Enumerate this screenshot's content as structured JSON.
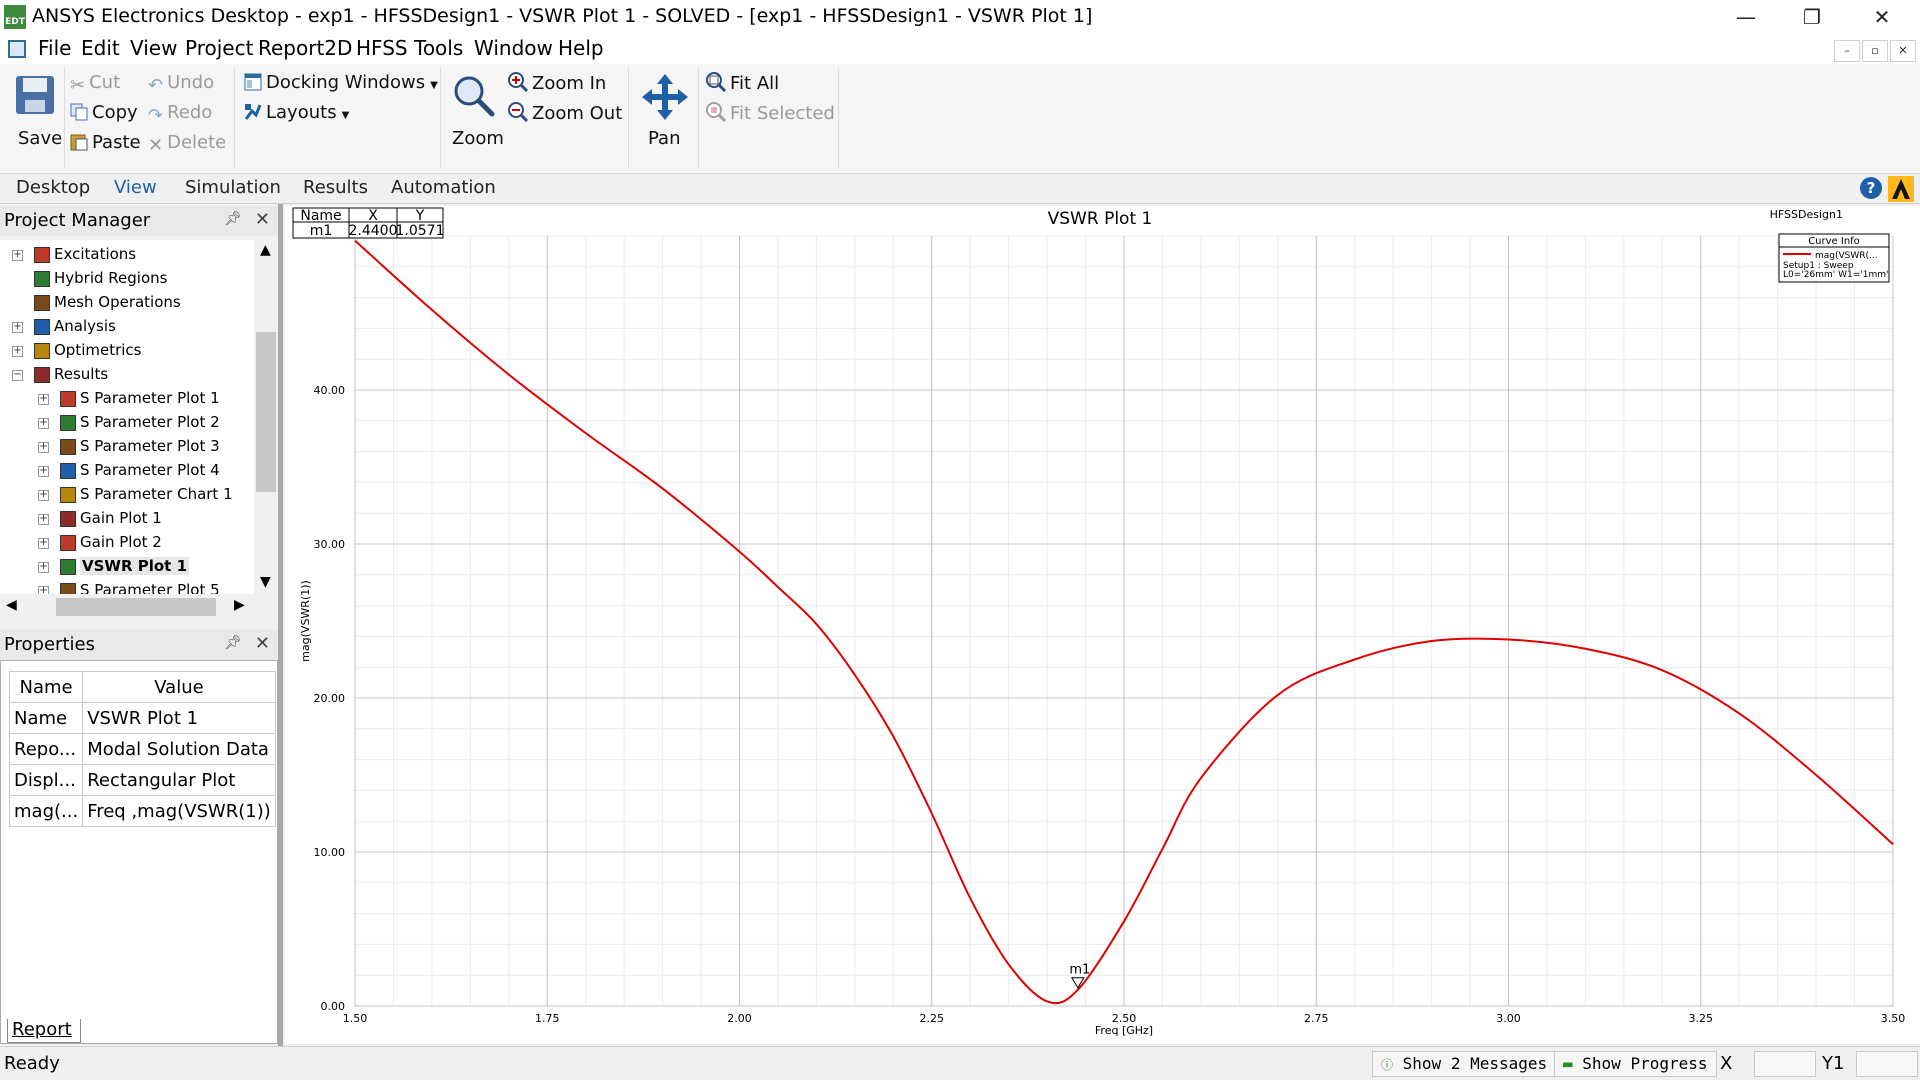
{
  "window": {
    "title": "ANSYS Electronics Desktop - exp1 - HFSSDesign1 - VSWR Plot 1 - SOLVED - [exp1 - HFSSDesign1 - VSWR Plot 1]",
    "app_icon_text": "EDT",
    "minimize": "—",
    "restore": "❐",
    "close": "✕"
  },
  "menu": {
    "items": [
      "File",
      "Edit",
      "View",
      "Project",
      "Report2D",
      "HFSS",
      "Tools",
      "Window",
      "Help"
    ]
  },
  "ribbon": {
    "save": "Save",
    "cut": "Cut",
    "copy": "Copy",
    "paste": "Paste",
    "undo": "Undo",
    "redo": "Redo",
    "delete": "Delete",
    "docking_windows": "Docking Windows",
    "layouts": "Layouts",
    "zoom": "Zoom",
    "zoom_in": "Zoom In",
    "zoom_out": "Zoom Out",
    "pan": "Pan",
    "fit_all": "Fit All",
    "fit_selected": "Fit Selected"
  },
  "tabs": [
    "Desktop",
    "View",
    "Simulation",
    "Results",
    "Automation"
  ],
  "active_tab": "View",
  "project_manager": {
    "title": "Project Manager",
    "items": [
      {
        "label": "Excitations",
        "level": 0,
        "expander": "+"
      },
      {
        "label": "Hybrid Regions",
        "level": 0,
        "expander": ""
      },
      {
        "label": "Mesh Operations",
        "level": 0,
        "expander": ""
      },
      {
        "label": "Analysis",
        "level": 0,
        "expander": "+"
      },
      {
        "label": "Optimetrics",
        "level": 0,
        "expander": "+"
      },
      {
        "label": "Results",
        "level": 0,
        "expander": "−"
      },
      {
        "label": "S Parameter Plot 1",
        "level": 1,
        "expander": "+"
      },
      {
        "label": "S Parameter Plot 2",
        "level": 1,
        "expander": "+"
      },
      {
        "label": "S Parameter Plot 3",
        "level": 1,
        "expander": "+"
      },
      {
        "label": "S Parameter Plot 4",
        "level": 1,
        "expander": "+"
      },
      {
        "label": "S Parameter Chart 1",
        "level": 1,
        "expander": "+"
      },
      {
        "label": "Gain Plot 1",
        "level": 1,
        "expander": "+"
      },
      {
        "label": "Gain Plot 2",
        "level": 1,
        "expander": "+"
      },
      {
        "label": "VSWR Plot 1",
        "level": 1,
        "expander": "+",
        "selected": true
      },
      {
        "label": "S Parameter Plot 5",
        "level": 1,
        "expander": "+"
      }
    ]
  },
  "properties": {
    "title": "Properties",
    "header_name": "Name",
    "header_value": "Value",
    "rows": [
      {
        "name": "Name",
        "value": "VSWR Plot 1"
      },
      {
        "name": "Repo...",
        "value": "Modal Solution Data"
      },
      {
        "name": "Displ...",
        "value": "Rectangular Plot"
      },
      {
        "name": "mag(...",
        "value": "Freq ,mag(VSWR(1))"
      }
    ],
    "tab": "Report"
  },
  "plot": {
    "design_label": "HFSSDesign1",
    "curve_info_title": "Curve Info",
    "curve_info_line1": "mag(VSWR(...",
    "curve_info_line2": "Setup1 : Sweep",
    "curve_info_line3": "L0='26mm' W1='1mm'",
    "marker_table": {
      "headers": [
        "Name",
        "X",
        "Y"
      ],
      "row": [
        "m1",
        "2.4400",
        "1.0571"
      ]
    },
    "marker_label": "m1",
    "curve_color": "#e00000"
  },
  "chart_data": {
    "type": "line",
    "title": "VSWR Plot 1",
    "xlabel": "Freq [GHz]",
    "ylabel": "mag(VSWR(1))",
    "xlim": [
      1.5,
      3.5
    ],
    "ylim": [
      0,
      50
    ],
    "xticks": [
      "1.50",
      "1.75",
      "2.00",
      "2.25",
      "2.50",
      "2.75",
      "3.00",
      "3.25",
      "3.50"
    ],
    "yticks": [
      "0.00",
      "10.00",
      "20.00",
      "30.00",
      "40.00"
    ],
    "grid": true,
    "series": [
      {
        "name": "mag(VSWR(...",
        "x": [
          1.5,
          1.6,
          1.7,
          1.8,
          1.9,
          2.0,
          2.05,
          2.1,
          2.15,
          2.2,
          2.25,
          2.3,
          2.35,
          2.4,
          2.44,
          2.5,
          2.55,
          2.6,
          2.7,
          2.8,
          2.9,
          3.0,
          3.1,
          3.2,
          3.3,
          3.4,
          3.5
        ],
        "y": [
          49.7,
          45.2,
          41.0,
          37.2,
          33.6,
          29.5,
          27.2,
          24.8,
          21.5,
          17.5,
          12.5,
          7.0,
          2.7,
          0.3,
          1.06,
          5.5,
          10.2,
          14.8,
          20.2,
          22.5,
          23.7,
          23.8,
          23.2,
          21.8,
          19.0,
          15.0,
          10.5
        ]
      }
    ],
    "markers": [
      {
        "name": "m1",
        "x": 2.44,
        "y": 1.0571
      }
    ]
  },
  "status": {
    "text": "Ready",
    "messages": "Show 2 Messages",
    "progress": "Show Progress",
    "x_label": "X",
    "y_label": "Y1"
  }
}
